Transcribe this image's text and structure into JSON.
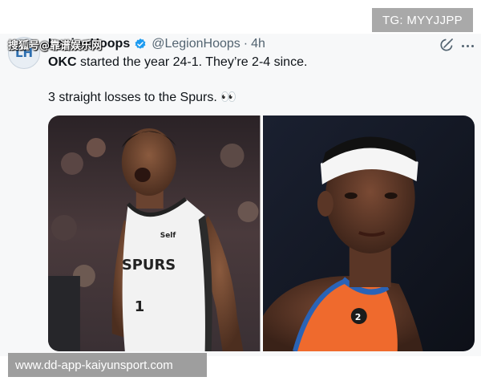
{
  "overlay": {
    "tg_badge": "TG: MYYJJPP",
    "watermark": "搜狐号@靠谱娱乐网",
    "url_banner": "www.dd-app-kaiyunsport.com"
  },
  "tweet": {
    "avatar_text": "LH",
    "display_name": "LegionHoops",
    "handle": "@LegionHoops",
    "separator": "·",
    "time": "4h",
    "line1_bold": "OKC",
    "line1_rest": " started the year 24-1. They’re 2-4 since.",
    "line2": "3 straight losses to the Spurs. 👀",
    "icons": [
      "verified-badge-icon",
      "grok-icon",
      "more-options-icon"
    ],
    "media": [
      {
        "name": "spurs-player-photo",
        "jersey_brand": "Self",
        "jersey_team": "SPURS",
        "jersey_number": "1"
      },
      {
        "name": "thunder-player-photo",
        "jersey_number": "2"
      }
    ]
  },
  "colors": {
    "accent": "#1d9bf0",
    "text": "#0f1419",
    "secondary_text": "#536471",
    "thunder_orange": "#ef6a2d",
    "thunder_blue": "#2a63b6"
  }
}
